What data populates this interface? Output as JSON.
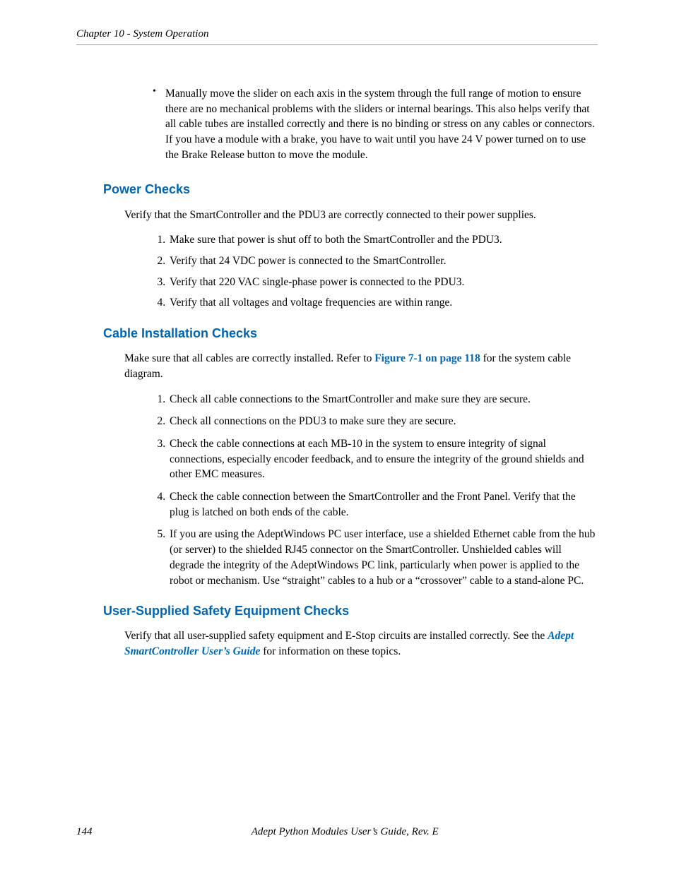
{
  "header": {
    "chapter": "Chapter 10 - System Operation"
  },
  "intro_bullet": "Manually move the slider on each axis in the system through the full range of motion to ensure there are no mechanical problems with the sliders or internal bearings. This also helps verify that all cable tubes are installed correctly and there is no binding or stress on any cables or connectors. If you have a module with a brake, you have to wait until you have 24 V power turned on to use the Brake Release button to move the module.",
  "sec1": {
    "title": "Power Checks",
    "intro": "Verify that the SmartController and the PDU3 are correctly connected to their power supplies.",
    "items": [
      "Make sure that power is shut off to both the SmartController and the PDU3.",
      "Verify that 24 VDC power is connected to the SmartController.",
      "Verify that 220 VAC single-phase power is connected to the PDU3.",
      "Verify that all voltages and voltage frequencies are within range."
    ]
  },
  "sec2": {
    "title": "Cable Installation Checks",
    "intro_pre": "Make sure that all cables are correctly installed. Refer to ",
    "intro_link": "Figure 7-1 on page 118",
    "intro_post": " for the system cable diagram.",
    "items": [
      "Check all cable connections to the SmartController and make sure they are secure.",
      "Check all connections on the PDU3 to make sure they are secure.",
      "Check the cable connections at each MB-10 in the system to ensure integrity of signal connections, especially encoder feedback, and to ensure the integrity of the ground shields and other EMC measures.",
      "Check the cable connection between the SmartController and the Front Panel. Verify that the plug is latched on both ends of the cable.",
      "If you are using the AdeptWindows PC user interface, use a shielded Ethernet cable from the hub (or server) to the shielded RJ45 connector on the SmartController. Unshielded cables will degrade the integrity of the AdeptWindows PC link, particularly when power is applied to the robot or mechanism. Use “straight” cables to a hub or a “crossover” cable to a stand-alone PC."
    ]
  },
  "sec3": {
    "title": "User-Supplied Safety Equipment Checks",
    "text_pre": "Verify that all user-supplied safety equipment and E-Stop circuits are installed correctly. See the ",
    "text_link": "Adept SmartController User’s Guide",
    "text_post": " for information on these topics."
  },
  "footer": {
    "page": "144",
    "title": "Adept Python Modules User’s Guide, Rev. E"
  }
}
